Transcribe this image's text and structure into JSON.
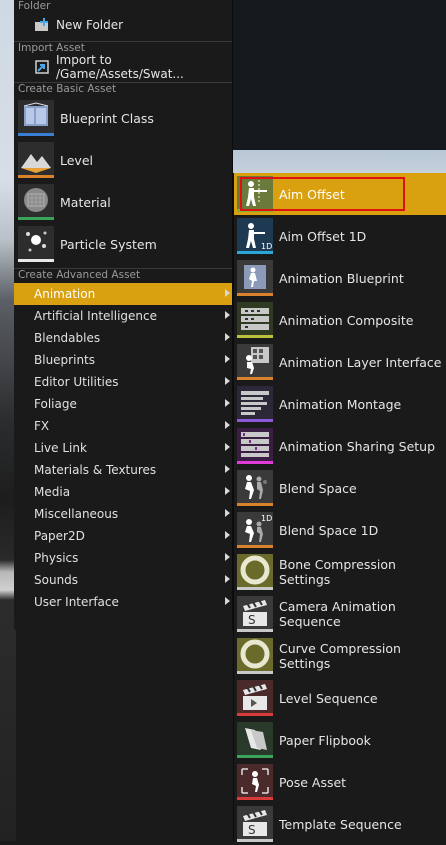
{
  "menu": {
    "folder_header": "Folder",
    "new_folder": "New Folder",
    "import_header": "Import Asset",
    "import_label": "Import to /Game/Assets/Swat...",
    "basic_header": "Create Basic Asset",
    "basic_assets": [
      {
        "label": "Blueprint Class",
        "icon": "blueprint-class-icon",
        "bar_color": "#3a7fd5"
      },
      {
        "label": "Level",
        "icon": "level-icon",
        "bar_color": "#d9822b"
      },
      {
        "label": "Material",
        "icon": "material-icon",
        "bar_color": "#3aa55a"
      },
      {
        "label": "Particle System",
        "icon": "particle-system-icon",
        "bar_color": "#e8e8e8"
      }
    ],
    "advanced_header": "Create Advanced Asset",
    "categories": [
      "Animation",
      "Artificial Intelligence",
      "Blendables",
      "Blueprints",
      "Editor Utilities",
      "Foliage",
      "FX",
      "Live Link",
      "Materials & Textures",
      "Media",
      "Miscellaneous",
      "Paper2D",
      "Physics",
      "Sounds",
      "User Interface"
    ],
    "selected_category": "Animation"
  },
  "submenu": {
    "items": [
      {
        "label": "Aim Offset",
        "icon": "aim-offset-icon",
        "bar_color": "#7fb03a"
      },
      {
        "label": "Aim Offset 1D",
        "icon": "aim-offset-1d-icon",
        "bar_color": "#2aa6d8"
      },
      {
        "label": "Animation Blueprint",
        "icon": "animation-blueprint-icon",
        "bar_color": "#d9822b"
      },
      {
        "label": "Animation Composite",
        "icon": "animation-composite-icon",
        "bar_color": "#b9c23a"
      },
      {
        "label": "Animation Layer Interface",
        "icon": "animation-layer-interface-icon",
        "bar_color": "#d9822b"
      },
      {
        "label": "Animation Montage",
        "icon": "animation-montage-icon",
        "bar_color": "#8a5ad9"
      },
      {
        "label": "Animation Sharing Setup",
        "icon": "animation-sharing-setup-icon",
        "bar_color": "#e03ad9"
      },
      {
        "label": "Blend Space",
        "icon": "blend-space-icon",
        "bar_color": "#d9822b"
      },
      {
        "label": "Blend Space 1D",
        "icon": "blend-space-1d-icon",
        "bar_color": "#d9822b"
      },
      {
        "label": "Bone Compression Settings",
        "icon": "bone-compression-settings-icon",
        "bar_color": "#c8c8c8"
      },
      {
        "label": "Camera Animation Sequence",
        "icon": "camera-animation-sequence-icon",
        "bar_color": "#c8c8c8"
      },
      {
        "label": "Curve Compression Settings",
        "icon": "curve-compression-settings-icon",
        "bar_color": "#c8c8c8"
      },
      {
        "label": "Level Sequence",
        "icon": "level-sequence-icon",
        "bar_color": "#d93a3a"
      },
      {
        "label": "Paper Flipbook",
        "icon": "paper-flipbook-icon",
        "bar_color": "#3aa55a"
      },
      {
        "label": "Pose Asset",
        "icon": "pose-asset-icon",
        "bar_color": "#d93a3a"
      },
      {
        "label": "Template Sequence",
        "icon": "template-sequence-icon",
        "bar_color": "#c8c8c8"
      }
    ],
    "selected_item": "Aim Offset",
    "highlight_color": "#e01010"
  },
  "colors": {
    "accent": "#d9a010",
    "menu_bg": "#1a1a1a"
  }
}
